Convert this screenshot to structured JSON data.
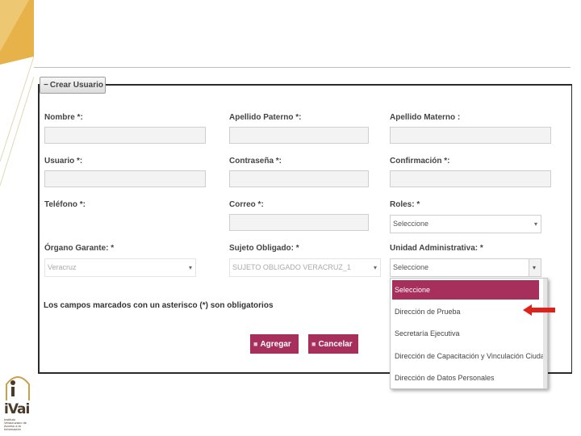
{
  "form": {
    "legend": "Crear Usuario",
    "fields": {
      "nombre": "Nombre *:",
      "apellido_paterno": "Apellido Paterno *:",
      "apellido_materno": "Apellido Materno :",
      "usuario": "Usuario *:",
      "contrasena": "Contraseña *:",
      "confirmacion": "Confirmación *:",
      "telefono": "Teléfono *:",
      "correo": "Correo *:",
      "roles": "Roles: *",
      "organo_garante": "Órgano Garante: *",
      "sujeto_obligado": "Sujeto Obligado: *",
      "unidad_administrativa": "Unidad Administrativa: *"
    },
    "selects": {
      "roles_value": "Seleccione",
      "organo_value": "Veracruz",
      "sujeto_value": "SUJETO OBLIGADO VERACRUZ_1",
      "unidad_value": "Seleccione"
    },
    "note": "Los campos marcados con un asterisco (*) son obligatorios",
    "buttons": {
      "agregar": "Agregar",
      "cancelar": "Cancelar"
    },
    "dropdown_options": [
      "Seleccione",
      "Dirección de Prueba",
      "Secretaría Ejecutiva",
      "Dirección de Capacitación y Vinculación Ciuda",
      "Dirección de Datos Personales"
    ]
  },
  "branding": {
    "logo_text": "iVai",
    "logo_tagline": "Instituto Veracruzano de Acceso a la Información"
  },
  "colors": {
    "accent": "#a62f5b",
    "arrow": "#e0201b",
    "panel_border": "#2a2a2a"
  },
  "icons": {
    "collapse": "minus-icon",
    "caret": "caret-down-icon",
    "add": "add-icon",
    "cancel": "cancel-icon"
  }
}
